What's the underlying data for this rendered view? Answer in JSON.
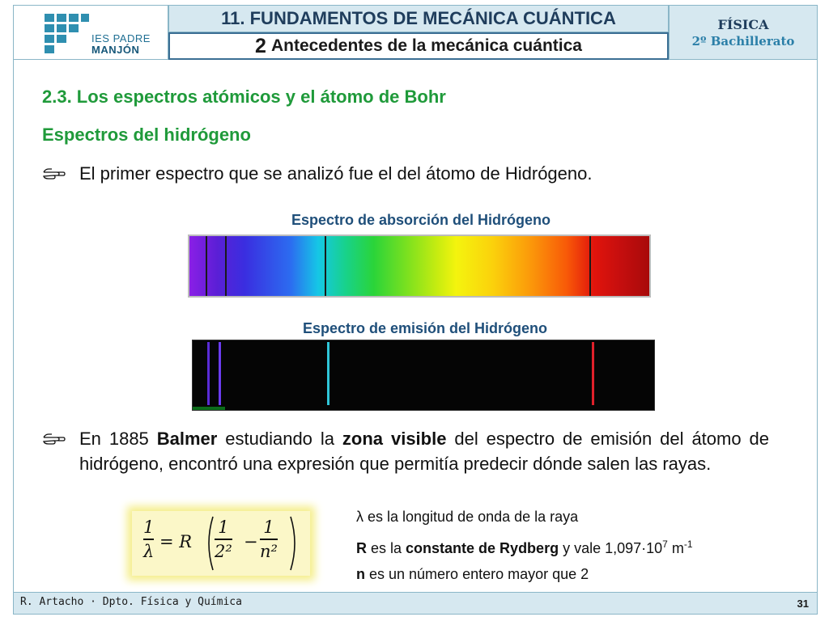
{
  "header": {
    "logo_line1": "IES PADRE",
    "logo_line2": "MANJÓN",
    "unit_title": "11. FUNDAMENTOS DE MECÁNICA CUÁNTICA",
    "section_number": "2",
    "section_title": "Antecedentes de la mecánica cuántica",
    "subject": "FÍSICA",
    "course": "2º Bachillerato"
  },
  "content": {
    "section_heading": "2.3. Los espectros atómicos y el átomo de Bohr",
    "sub_heading": "Espectros del hidrógeno",
    "bullet1": "El primer espectro que se analizó  fue el del átomo de Hidrógeno.",
    "absorption_label": "Espectro de absorción del Hidrógeno",
    "emission_label": "Espectro de emisión del Hidrógeno",
    "bullet2_parts": {
      "p1": "En 1885 ",
      "b1": "Balmer",
      "p2": " estudiando la ",
      "b2": "zona visible",
      "p3": " del espectro de emisión del átomo de hidrógeno, encontró una expresión que permitía predecir dónde salen las rayas."
    },
    "formula": {
      "lhs_num": "1",
      "lhs_den": "λ",
      "equals_r": "= R",
      "t1_num": "1",
      "t1_den": "2²",
      "minus": "−",
      "t2_num": "1",
      "t2_den": "n²"
    },
    "legend": {
      "lambda_symbol": "λ",
      "lambda_text": " es la longitud de onda de la raya",
      "r_symbol": "R",
      "r_text1": " es la ",
      "r_bold": "constante de Rydberg",
      "r_text2": " y vale 1,097·10",
      "r_exp": "7",
      "r_unit": " m",
      "r_unit_exp": "-1",
      "n_symbol": "n",
      "n_text": " es un número entero mayor que 2"
    }
  },
  "colors": {
    "heading_green": "#1f9a3a",
    "label_blue": "#1f4f7a",
    "header_fill": "#d6e8f0",
    "emission_violet": "#5a2bd6",
    "emission_blue": "#6b3cf0",
    "emission_cyan": "#2fc6d8",
    "emission_red": "#e0202a"
  },
  "footer": {
    "author": "R. Artacho · Dpto. Física y Química",
    "page": "31"
  }
}
